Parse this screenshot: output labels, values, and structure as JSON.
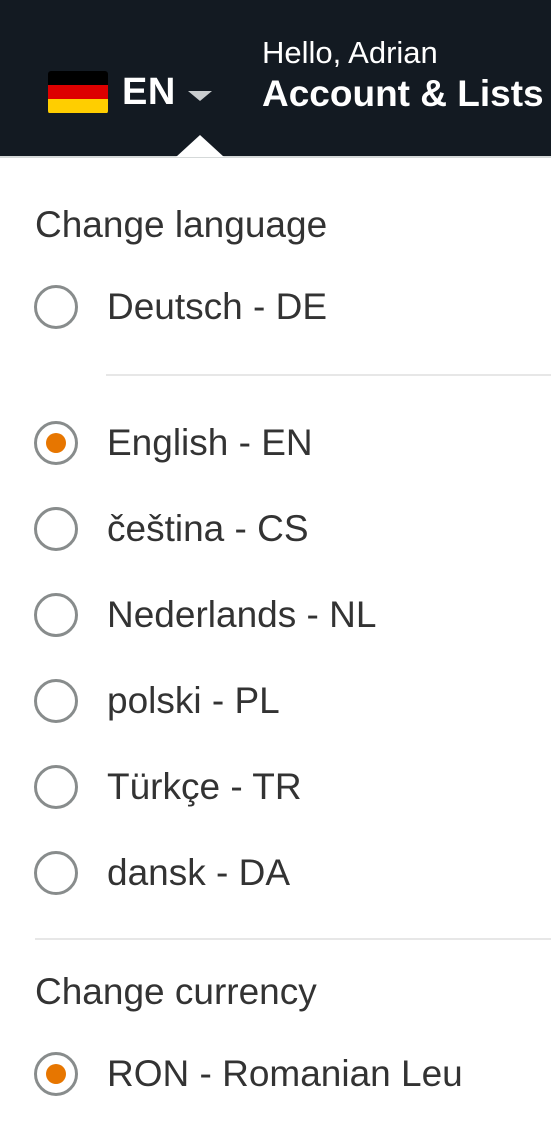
{
  "header": {
    "flag_icon": "germany-flag-icon",
    "flag_colors": [
      "#000000",
      "#dd0000",
      "#ffce00"
    ],
    "language_code": "EN",
    "greeting": "Hello, Adrian",
    "account_label": "Account & Lists"
  },
  "language_section": {
    "title": "Change language",
    "primary_option": {
      "label": "Deutsch - DE",
      "selected": false
    },
    "options": [
      {
        "label": "English - EN",
        "selected": true
      },
      {
        "label": "čeština - CS",
        "selected": false
      },
      {
        "label": "Nederlands - NL",
        "selected": false
      },
      {
        "label": "polski - PL",
        "selected": false
      },
      {
        "label": "Türkçe - TR",
        "selected": false
      },
      {
        "label": "dansk - DA",
        "selected": false
      }
    ]
  },
  "currency_section": {
    "title": "Change currency",
    "options": [
      {
        "label": "RON - Romanian Leu",
        "selected": true
      }
    ]
  },
  "colors": {
    "header_bg": "#131a22",
    "accent": "#e77600",
    "text": "#333333"
  }
}
